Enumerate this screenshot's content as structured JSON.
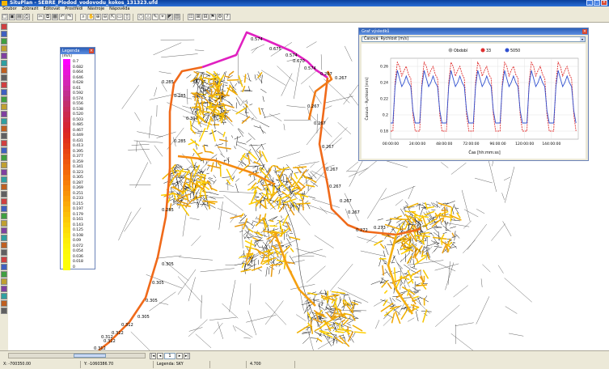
{
  "window": {
    "title": "SituPlan - SEBRE_Plodod_vodovodu_kokos_131323.ufd"
  },
  "menu": [
    "Soubor",
    "Zobrazit",
    "Editovat",
    "Prostředí",
    "Nástroje",
    "Nápověda"
  ],
  "legend": {
    "title": "Legenda",
    "unit": "[m/s]",
    "entries": [
      {
        "label": "0.7",
        "color": "#ff00ff"
      },
      {
        "label": "0.682",
        "color": "#f30ce9"
      },
      {
        "label": "0.664",
        "color": "#e816d8"
      },
      {
        "label": "0.646",
        "color": "#de1fc6"
      },
      {
        "label": "0.628",
        "color": "#d426b4"
      },
      {
        "label": "0.61",
        "color": "#cc2ca2"
      },
      {
        "label": "0.592",
        "color": "#c32f8f"
      },
      {
        "label": "0.574",
        "color": "#c0307f"
      },
      {
        "label": "0.556",
        "color": "#c42f6e"
      },
      {
        "label": "0.538",
        "color": "#c82d5f"
      },
      {
        "label": "0.520",
        "color": "#cc2a50"
      },
      {
        "label": "0.503",
        "color": "#d02843"
      },
      {
        "label": "0.485",
        "color": "#d52536"
      },
      {
        "label": "0.467",
        "color": "#d9242a"
      },
      {
        "label": "0.449",
        "color": "#dd2a22"
      },
      {
        "label": "0.431",
        "color": "#e1311c"
      },
      {
        "label": "0.413",
        "color": "#e43a18"
      },
      {
        "label": "0.395",
        "color": "#e84414"
      },
      {
        "label": "0.377",
        "color": "#eb4d12"
      },
      {
        "label": "0.359",
        "color": "#ee5710"
      },
      {
        "label": "0.341",
        "color": "#f1600e"
      },
      {
        "label": "0.323",
        "color": "#f36a0d"
      },
      {
        "label": "0.305",
        "color": "#f5740c"
      },
      {
        "label": "0.287",
        "color": "#f77e0b"
      },
      {
        "label": "0.269",
        "color": "#f8890b"
      },
      {
        "label": "0.251",
        "color": "#f9930b"
      },
      {
        "label": "0.233",
        "color": "#fa9e0b"
      },
      {
        "label": "0.215",
        "color": "#fba90b"
      },
      {
        "label": "0.197",
        "color": "#fbb40b"
      },
      {
        "label": "0.179",
        "color": "#fcbf0b"
      },
      {
        "label": "0.161",
        "color": "#fcc90b"
      },
      {
        "label": "0.143",
        "color": "#fdd30b"
      },
      {
        "label": "0.125",
        "color": "#fddc0b"
      },
      {
        "label": "0.108",
        "color": "#fde50b"
      },
      {
        "label": "0.09",
        "color": "#fded0b"
      },
      {
        "label": "0.072",
        "color": "#fdf30b"
      },
      {
        "label": "0.054",
        "color": "#fdf80b"
      },
      {
        "label": "0.036",
        "color": "#fdfb0b"
      },
      {
        "label": "0.018",
        "color": "#fdfd0b"
      },
      {
        "label": "0",
        "color": "#fdfe0b"
      }
    ]
  },
  "map_labels": [
    {
      "text": "0.574"
    },
    {
      "text": "0.675"
    },
    {
      "text": "0.574"
    },
    {
      "text": "0.670"
    },
    {
      "text": "0.574"
    },
    {
      "text": "0.267"
    },
    {
      "text": "0.267"
    },
    {
      "text": "0.285"
    },
    {
      "text": "0.285"
    },
    {
      "text": "0.307"
    },
    {
      "text": "0.267"
    },
    {
      "text": "0.267"
    },
    {
      "text": "0.267"
    },
    {
      "text": "0.267"
    },
    {
      "text": "0.267"
    },
    {
      "text": "0.267"
    },
    {
      "text": "0.267"
    },
    {
      "text": "0.285"
    },
    {
      "text": "0.285"
    },
    {
      "text": "0.305"
    },
    {
      "text": "0.305"
    },
    {
      "text": "0.305"
    },
    {
      "text": "0.305"
    },
    {
      "text": "0.312"
    },
    {
      "text": "0.312"
    },
    {
      "text": "0.312"
    },
    {
      "text": "0.312"
    },
    {
      "text": "0.312"
    },
    {
      "text": "0.272"
    },
    {
      "text": "0.273"
    }
  ],
  "graph_window": {
    "title": "Graf výsledků",
    "selector": "Časová: Rychlost [m/s]",
    "legend": [
      {
        "name": "Období",
        "color": "#aaaaaa"
      },
      {
        "name": "33",
        "color": "#e03030"
      },
      {
        "name": "5050",
        "color": "#3050d0"
      }
    ],
    "ylabel": "Časová - Rychlost [m/s]",
    "xlabel": "Čas [hh:mm:ss]",
    "x_ticks": [
      "00:00:00",
      "24:00:00",
      "48:00:00",
      "72:00:00",
      "96:00:00",
      "120:00:00",
      "144:00:00"
    ],
    "y_ticks": [
      "0.26",
      "0.24",
      "0.22",
      "0.2",
      "0.18"
    ]
  },
  "chart_data": {
    "type": "line",
    "title": "",
    "xlabel": "Čas [hh:mm:ss]",
    "ylabel": "Časová - Rychlost [m/s]",
    "x": [
      0,
      2,
      4,
      6,
      8,
      10,
      12,
      14,
      16,
      18,
      20,
      22
    ],
    "ylim": [
      0.17,
      0.27
    ],
    "series": [
      {
        "name": "33",
        "color": "#e03030",
        "values": [
          0.18,
          0.18,
          0.24,
          0.265,
          0.26,
          0.248,
          0.255,
          0.26,
          0.25,
          0.245,
          0.2,
          0.18
        ]
      },
      {
        "name": "5050",
        "color": "#3050d0",
        "values": [
          0.19,
          0.19,
          0.235,
          0.255,
          0.245,
          0.235,
          0.24,
          0.248,
          0.24,
          0.235,
          0.205,
          0.19
        ]
      }
    ],
    "period_hours": 24,
    "days": 7
  },
  "status": {
    "page": "1",
    "fields": [
      "X: -700350.00",
      "Y: -1060386.70",
      "Legenda: SKY",
      "",
      "4.700"
    ]
  }
}
